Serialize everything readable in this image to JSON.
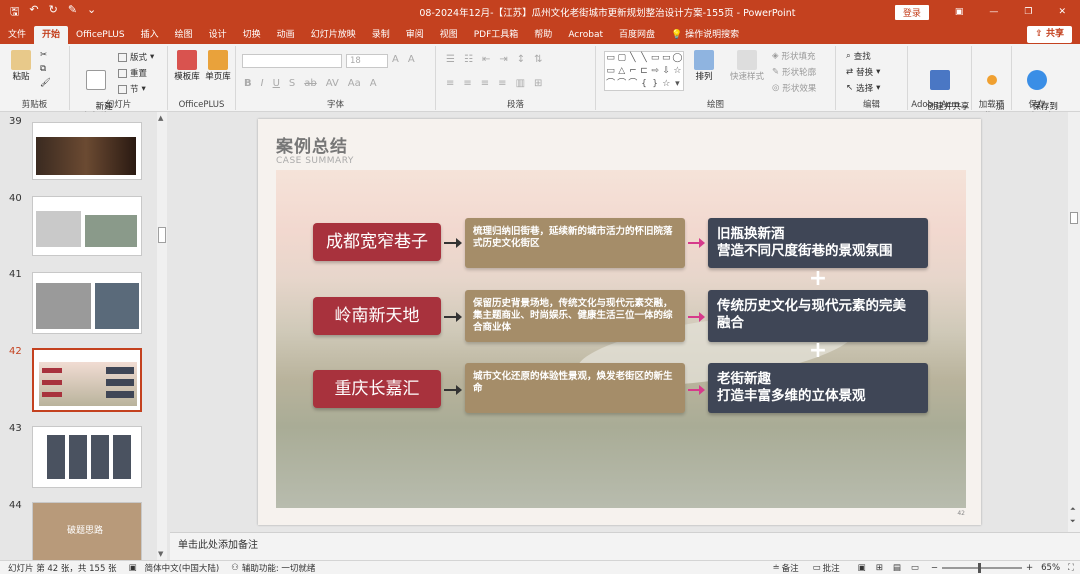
{
  "app": {
    "window_title": "08-2024年12月-【江苏】瓜州文化老街城市更新规划整治设计方案-155页  -  PowerPoint",
    "login_label": "登录",
    "share_label": "共享"
  },
  "menu": [
    "文件",
    "开始",
    "OfficePLUS",
    "插入",
    "绘图",
    "设计",
    "切换",
    "动画",
    "幻灯片放映",
    "录制",
    "审阅",
    "视图",
    "PDF工具箱",
    "帮助",
    "Acrobat",
    "百度网盘",
    "操作说明搜索"
  ],
  "ribbon": {
    "clipboard": {
      "paste": "粘贴",
      "label": "剪贴板"
    },
    "slides": {
      "new_slide": "新建\n幻灯片",
      "layout": "版式",
      "reset": "重置",
      "section": "节",
      "label": "幻灯片"
    },
    "officeplus": {
      "template": "模板库",
      "single": "单页库",
      "label": "OfficePLUS"
    },
    "font": {
      "size": "18",
      "label": "字体"
    },
    "paragraph": {
      "label": "段落"
    },
    "drawing": {
      "arrange": "排列",
      "quick_styles": "快速样式",
      "fill": "形状填充",
      "outline": "形状轮廓",
      "effects": "形状效果",
      "label": "绘图"
    },
    "editing": {
      "find": "查找",
      "replace": "替换",
      "select": "选择",
      "label": "编辑"
    },
    "adobe": {
      "create": "创建并共享\nAdobe PDF",
      "label": "Adobe Acro..."
    },
    "addins": {
      "btn": "加\n载项",
      "label": "加载项"
    },
    "save": {
      "btn": "保存到\n百度网盘",
      "label": "保存"
    }
  },
  "thumbnails": [
    {
      "num": "39"
    },
    {
      "num": "40"
    },
    {
      "num": "41"
    },
    {
      "num": "42",
      "active": true
    },
    {
      "num": "43"
    },
    {
      "num": "44",
      "title": "破题思路"
    }
  ],
  "slide": {
    "title": "案例总结",
    "subtitle": "CASE SUMMARY",
    "page_number": "42",
    "rows": [
      {
        "city": "成都宽窄巷子",
        "desc": "梳理归纳旧街巷，延续新的城市活力的怀旧院落式历史文化街区",
        "result": "旧瓶换新酒\n营造不同尺度街巷的景观氛围"
      },
      {
        "city": "岭南新天地",
        "desc": "保留历史背景场地，传统文化与现代元素交融，集主题商业、时尚娱乐、健康生活三位一体的综合商业体",
        "result": "传统历史文化与现代元素的完美融合"
      },
      {
        "city": "重庆长嘉汇",
        "desc": "城市文化还原的体验性景观，焕发老街区的新生命",
        "result": "老街新趣\n打造丰富多维的立体景观"
      }
    ]
  },
  "notes_placeholder": "单击此处添加备注",
  "status": {
    "slide_info": "幻灯片 第 42 张，共 155 张",
    "language": "简体中文(中国大陆)",
    "accessibility": "辅助功能: 一切就绪",
    "notes": "备注",
    "comments": "批注",
    "zoom": "65%"
  },
  "colors": {
    "accent": "#c4411f",
    "city_box": "#a8323d",
    "desc_box": "#a58d69",
    "result_box": "#3f4656",
    "pink_arrow": "#d63a8b"
  }
}
